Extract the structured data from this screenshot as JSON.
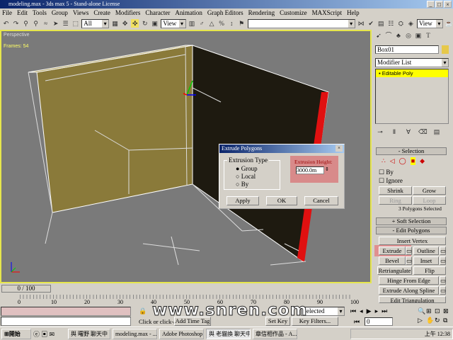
{
  "window": {
    "title": "modeling.max - 3ds max 5 - Stand-alone License",
    "controls": [
      "_",
      "□",
      "×"
    ]
  },
  "menu": [
    "File",
    "Edit",
    "Tools",
    "Group",
    "Views",
    "Create",
    "Modifiers",
    "Character",
    "Animation",
    "Graph Editors",
    "Rendering",
    "Customize",
    "MAXScript",
    "Help"
  ],
  "toolbar": {
    "selection_filter": "All",
    "ref_coord": "View",
    "named_sel": "",
    "view2": "View"
  },
  "viewport": {
    "label": "Perspective",
    "frames": "Frames: 54"
  },
  "panel": {
    "object_name": "Box01",
    "object_color": "#e6c84a",
    "modifier_list": "Modifier List",
    "stack_item": "Editable Poly",
    "selection": {
      "header": "Selection",
      "by": "By",
      "ignore": "Ignore",
      "shrink": "Shrink",
      "grow": "Grow",
      "ring": "Ring",
      "loop": "Loop",
      "status": "3 Polygons Selected"
    },
    "soft_selection": "Soft Selection",
    "edit_polygons": {
      "header": "Edit Polygons",
      "insert_vertex": "Insert Vertex",
      "extrude": "Extrude",
      "outline": "Outline",
      "bevel": "Bevel",
      "inset": "Inset",
      "retriangulate": "Retriangulate",
      "flip": "Flip",
      "hinge": "Hinge From Edge",
      "extrude_spline": "Extrude Along Spline",
      "edit_tri": "Edit Triangulation"
    }
  },
  "dialog": {
    "title": "Extrude Polygons",
    "type_label": "Extrusion Type",
    "options": [
      "Group",
      "Local",
      "By"
    ],
    "selected": "Group",
    "height_label": "Extrusion Height:",
    "height_value": "3000.0m",
    "apply": "Apply",
    "ok": "OK",
    "cancel": "Cancel"
  },
  "timeline": {
    "slider": "0 / 100",
    "ticks": [
      "0",
      "10",
      "20",
      "30",
      "40",
      "50",
      "60",
      "70",
      "80",
      "90",
      "100"
    ]
  },
  "status": {
    "prompt": "Click or click-and-drag to sele",
    "add_time_tag": "Add Time Tag",
    "set_key": "Set Key",
    "key_filters": "Key Filters...",
    "key_mode": "Selected",
    "frame": "0",
    "watermark": "www.snren.com"
  },
  "taskbar": {
    "start": "開始",
    "items": [
      "與 曙野 聊天中",
      "modeling.max - ...",
      "Adobe Photoshop",
      "與 老貓換 聊天中",
      "章信相作品 - A..."
    ],
    "clock": "上午 12:38"
  }
}
